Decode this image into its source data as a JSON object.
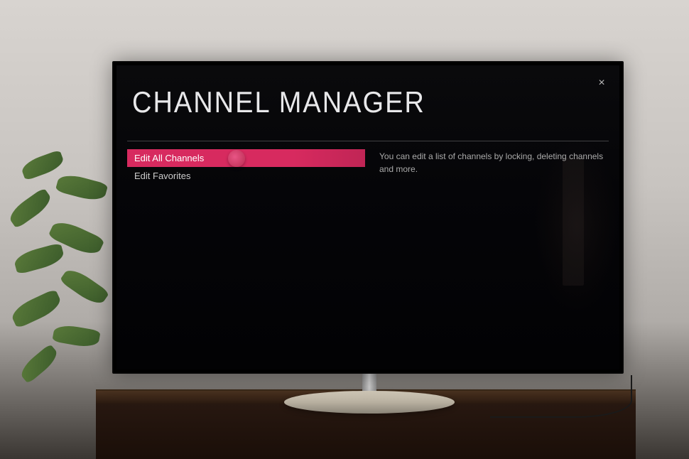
{
  "title": "CHANNEL MANAGER",
  "close_label": "×",
  "menu": {
    "items": [
      {
        "label": "Edit All Channels",
        "selected": true
      },
      {
        "label": "Edit Favorites",
        "selected": false
      }
    ]
  },
  "description": "You can edit a list of channels by locking, deleting channels and more.",
  "colors": {
    "accent": "#d72a5f",
    "text_primary": "#e8e8ea",
    "text_secondary": "#aaa"
  }
}
